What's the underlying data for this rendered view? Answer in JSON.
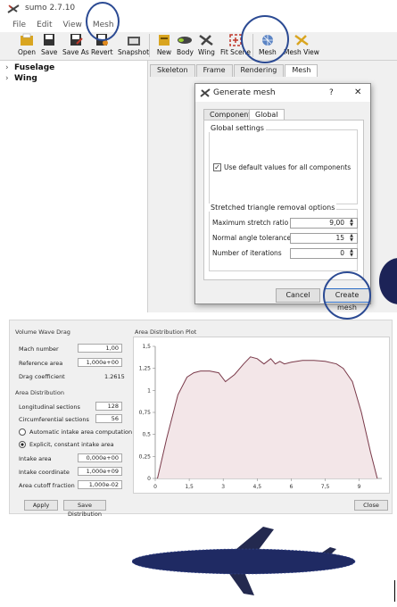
{
  "app": {
    "title": "sumo 2.7.10"
  },
  "menu": [
    "File",
    "Edit",
    "View",
    "Mesh"
  ],
  "toolbar": [
    {
      "label": "Open",
      "icon": "folder-icon"
    },
    {
      "label": "Save",
      "icon": "save-icon"
    },
    {
      "label": "Save As",
      "icon": "save-as-icon"
    },
    {
      "label": "Revert",
      "icon": "revert-icon"
    },
    {
      "label": "Snapshot",
      "icon": "camera-icon"
    },
    {
      "label": "New",
      "icon": "new-icon"
    },
    {
      "label": "Body",
      "icon": "body-icon"
    },
    {
      "label": "Wing",
      "icon": "wing-icon"
    },
    {
      "label": "Fit Scene",
      "icon": "fit-scene-icon"
    },
    {
      "label": "Mesh",
      "icon": "mesh-icon"
    },
    {
      "label": "Mesh View",
      "icon": "mesh-view-icon"
    }
  ],
  "tree": [
    {
      "label": "Fuselage"
    },
    {
      "label": "Wing"
    }
  ],
  "tabs": [
    "Skeleton",
    "Frame",
    "Rendering",
    "Mesh"
  ],
  "dialog": {
    "title": "Generate mesh",
    "help": "?",
    "close": "✕",
    "tabs": [
      "Component",
      "Global"
    ],
    "global_settings": "Global settings",
    "default_checkbox": "Use default values for all components",
    "stretched_title": "Stretched triangle removal options",
    "rows": [
      {
        "label": "Maximum stretch ratio",
        "value": "9,00"
      },
      {
        "label": "Normal angle tolerance",
        "value": "15"
      },
      {
        "label": "Number of iterations",
        "value": "0"
      }
    ],
    "cancel": "Cancel",
    "create": "Create mesh"
  },
  "wave_drag": {
    "title": "Volume Wave Drag",
    "mach_label": "Mach number",
    "mach_value": "1,00",
    "ref_label": "Reference area",
    "ref_value": "1,000e+00",
    "drag_label": "Drag coefficient",
    "drag_value": "1.2615",
    "area_title": "Area Distribution",
    "long_label": "Longitudinal sections",
    "long_value": "128",
    "circ_label": "Circumferential sections",
    "circ_value": "56",
    "radio_auto": "Automatic intake area computation",
    "radio_explicit": "Explicit, constant intake area",
    "intake_label": "Intake area",
    "intake_value": "0,000e+00",
    "coord_label": "Intake coordinate",
    "coord_value": "1,000e+09",
    "cutoff_label": "Area cutoff fraction",
    "cutoff_value": "1,000e-02",
    "apply": "Apply",
    "save_dist": "Save Distribution",
    "close": "Close"
  },
  "chart_data": {
    "type": "area",
    "title": "Area Distribution Plot",
    "xlim": [
      0,
      10
    ],
    "ylim": [
      0,
      1.5
    ],
    "xticks": [
      "0",
      "1,5",
      "3",
      "4,5",
      "6",
      "7,5",
      "9"
    ],
    "yticks": [
      "0",
      "0,25",
      "0,5",
      "0,75",
      "1",
      "1,25",
      "1,5"
    ],
    "x": [
      0.1,
      0.5,
      1.0,
      1.4,
      1.7,
      2.0,
      2.4,
      2.8,
      3.1,
      3.5,
      3.9,
      4.2,
      4.5,
      4.8,
      5.1,
      5.3,
      5.5,
      5.7,
      6.0,
      6.5,
      7.0,
      7.5,
      8.0,
      8.3,
      8.7,
      9.1,
      9.5,
      9.8
    ],
    "y": [
      0.0,
      0.45,
      0.95,
      1.15,
      1.2,
      1.22,
      1.22,
      1.2,
      1.1,
      1.18,
      1.3,
      1.38,
      1.36,
      1.3,
      1.36,
      1.3,
      1.33,
      1.3,
      1.32,
      1.34,
      1.34,
      1.33,
      1.3,
      1.25,
      1.1,
      0.75,
      0.3,
      0.0
    ],
    "color": "#7a3a4a",
    "fill": "#f3e6e8"
  }
}
